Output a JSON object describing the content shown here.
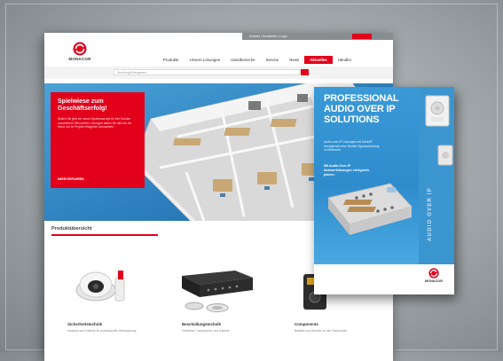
{
  "site": {
    "top_links": "Kontakt  |  Newsletter  |  Login",
    "brand": "MONACOR",
    "nav": [
      "Produkte",
      "Unsere Lösungen",
      "Handbereiche",
      "Service",
      "News",
      "Aktuelles",
      "Händler"
    ],
    "nav_active_index": 5,
    "search_placeholder": "Suchbegriff eingeben",
    "promo": {
      "title": "Spielwiese zum Geschäftserfolg!",
      "text": "Wollen Sie jetzt ein neues Systemkonzept für Ihre Kunden ausarbeiten? Mit unseren Lösungen haben Sie alles an der Hand, um Ihr Projekt erfolgreich umzusetzen.",
      "link": "MEHR ERFAHREN"
    },
    "overview_title": "Produktübersicht",
    "products": [
      {
        "name": "Sicherheitstechnik",
        "desc": "Kameras und Zubehör für professionelle Überwachung"
      },
      {
        "name": "Beschallungstechnik",
        "desc": "Verstärker, Lautsprecher und Zubehör"
      },
      {
        "name": "Components",
        "desc": "Bauteile und Zubehör für den Fachhandel"
      }
    ]
  },
  "brochure": {
    "headline": "PROFESSIONAL AUDIO OVER IP SOLUTIONS",
    "sub": "Audio-over-IP Lösungen mit Dante® ermöglichen eine flexible Signalverteilung im Netzwerk.",
    "sub2": "Mit Audio-Over-IP Netzwerklösungen erfolgreich planen.",
    "vertical": "AUDIO OVER IP",
    "brand": "MONACOR"
  },
  "colors": {
    "accent": "#e3001b",
    "blue": "#2e8ccd"
  }
}
